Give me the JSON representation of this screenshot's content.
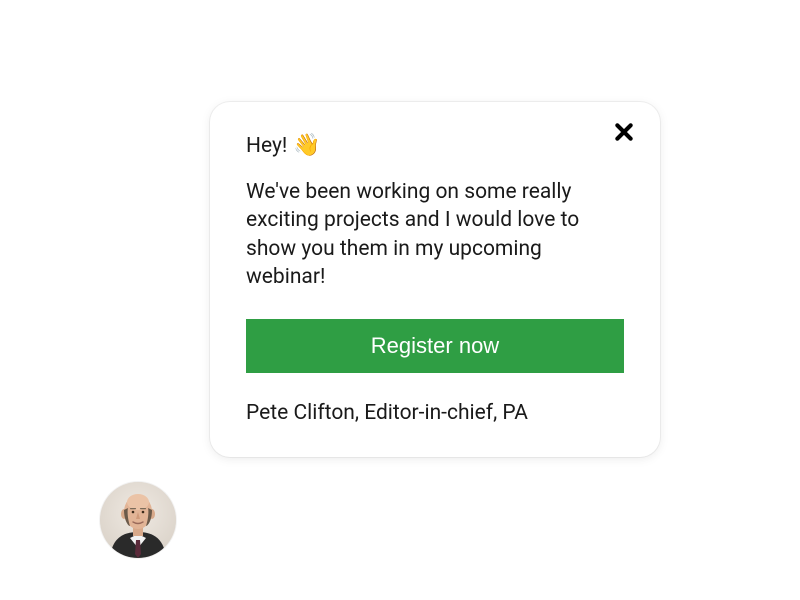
{
  "popup": {
    "greeting": "Hey!",
    "wave_emoji": "👋",
    "body": "We've been working on some really exciting projects and I would love to show you them in my upcoming webinar!",
    "cta_label": "Register now",
    "signature": "Pete Clifton, Editor-in-chief, PA"
  },
  "colors": {
    "cta_bg": "#2f9e44",
    "cta_text": "#ffffff"
  }
}
